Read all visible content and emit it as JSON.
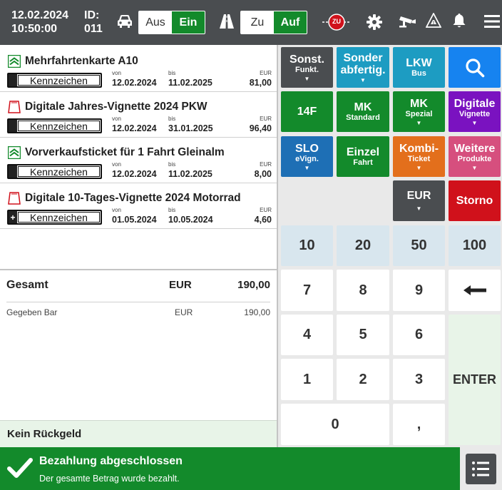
{
  "header": {
    "date": "12.02.2024",
    "time": "10:50:00",
    "id_label": "ID:",
    "id_value": "011",
    "vehicle_toggle": {
      "off": "Aus",
      "on": "Ein"
    },
    "road_toggle": {
      "off": "Zu",
      "on": "Auf"
    },
    "zu_badge": "ZU",
    "icons": [
      "car-icon",
      "road-icon",
      "closed-sign-icon",
      "settings-icon",
      "camera-icon",
      "warning-icon",
      "bell-icon",
      "menu-icon"
    ]
  },
  "items": [
    {
      "title": "Mehrfahrtenkarte A10",
      "icon": "ticket-green-icon",
      "plate": "Kennzeichen",
      "plate_badge": "",
      "from_label": "von",
      "from": "12.02.2024",
      "to_label": "bis",
      "to": "11.02.2025",
      "cur": "EUR",
      "price": "81,00"
    },
    {
      "title": "Digitale Jahres-Vignette 2024 PKW",
      "icon": "vignette-red-icon",
      "plate": "Kennzeichen",
      "plate_badge": "",
      "from_label": "von",
      "from": "12.02.2024",
      "to_label": "bis",
      "to": "31.01.2025",
      "cur": "EUR",
      "price": "96,40"
    },
    {
      "title": "Vorverkaufsticket für 1 Fahrt Gleinalm",
      "icon": "ticket-green-icon",
      "plate": "Kennzeichen",
      "plate_badge": "",
      "from_label": "von",
      "from": "12.02.2024",
      "to_label": "bis",
      "to": "11.02.2025",
      "cur": "EUR",
      "price": "8,00"
    },
    {
      "title": "Digitale 10-Tages-Vignette 2024 Motorrad",
      "icon": "vignette-red-icon",
      "plate": "Kennzeichen",
      "plate_badge": "+",
      "from_label": "von",
      "from": "01.05.2024",
      "to_label": "bis",
      "to": "10.05.2024",
      "cur": "EUR",
      "price": "4,60"
    }
  ],
  "totals": {
    "total_label": "Gesamt",
    "total_cur": "EUR",
    "total_value": "190,00",
    "paid_label": "Gegeben Bar",
    "paid_cur": "EUR",
    "paid_value": "190,00",
    "change_label": "Kein Rückgeld"
  },
  "buttons": {
    "sonst": {
      "main": "Sonst.",
      "sub": "Funkt.",
      "arrow": "▼"
    },
    "sonder": {
      "main": "Sonder",
      "main2": "abfertig.",
      "arrow": "▼"
    },
    "lkw": {
      "main": "LKW",
      "sub": "Bus"
    },
    "f14": {
      "main": "14F"
    },
    "mk_std": {
      "main": "MK",
      "sub": "Standard"
    },
    "mk_sp": {
      "main": "MK",
      "sub": "Spezial",
      "arrow": "▼"
    },
    "digitale": {
      "main": "Digitale",
      "sub": "Vignette",
      "arrow": "▼"
    },
    "slo": {
      "main": "SLO",
      "sub": "eVign.",
      "arrow": "▼"
    },
    "einzel": {
      "main": "Einzel",
      "sub": "Fahrt"
    },
    "kombi": {
      "main": "Kombi-",
      "sub": "Ticket",
      "arrow": "▼"
    },
    "weitere": {
      "main": "Weitere",
      "sub": "Produkte",
      "arrow": "▼"
    },
    "eur": {
      "main": "EUR",
      "arrow": "▼"
    },
    "storno": {
      "main": "Storno"
    }
  },
  "quick_amounts": [
    "10",
    "20",
    "50",
    "100"
  ],
  "keypad": {
    "k7": "7",
    "k8": "8",
    "k9": "9",
    "k4": "4",
    "k5": "5",
    "k6": "6",
    "k1": "1",
    "k2": "2",
    "k3": "3",
    "k0": "0",
    "comma": ",",
    "enter": "ENTER"
  },
  "footer": {
    "title": "Bezahlung abgeschlossen",
    "subtitle": "Der gesamte Betrag wurde bezahlt."
  },
  "colors": {
    "header_bg": "#4a4d50",
    "green": "#138a2b",
    "teal": "#1d9cc2",
    "blue": "#1e6fb5",
    "bright_blue": "#1683f0",
    "purple": "#7a12c0",
    "orange": "#e36f1c",
    "pink": "#d64f7e",
    "red": "#d0111b",
    "dark_grey": "#4a4d50"
  }
}
